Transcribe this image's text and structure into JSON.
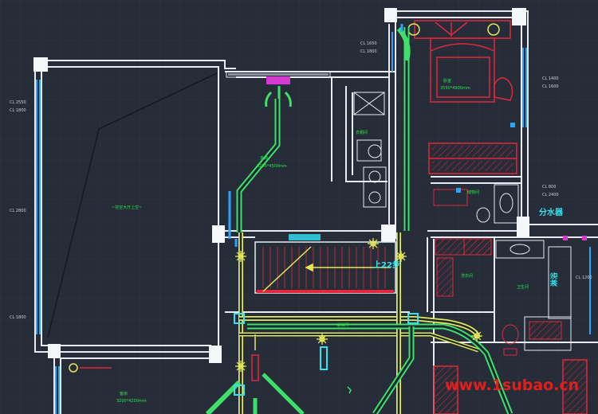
{
  "drawing": {
    "room_labels": {
      "large_room": "~挖空大厅上空~",
      "bedroom": "卧室",
      "bedroom_sub": "3550*4900mm",
      "mid_room": "走廊",
      "mid_room_sub": "3200*4500mm",
      "closet": "衣帽间",
      "stair_area": "楼梯间",
      "walk_in": "洗衣间",
      "bath": "卫生间",
      "bottom_left_room": "客房",
      "bottom_left_sub": "3200*4200mm",
      "storage": "储物间"
    },
    "divider_label": "分水器",
    "stair_label": "上22步",
    "shower_label": "淋浴",
    "dims_left": [
      "CL 2550",
      "CL 1800",
      "CL 2800",
      "CL 1800"
    ],
    "dims_right": [
      "CL 1400",
      "CL 1600",
      "CL 800",
      "CL 2400",
      "CL 1200"
    ],
    "dims_top": [
      "CL 1650",
      "CL 1800"
    ]
  },
  "watermark": {
    "text": "www.1subao.cn",
    "color": "#e0201c"
  },
  "colors": {
    "background": "#262c38",
    "grid": "#343c4a",
    "wall": "#e6ecf2",
    "pipe_green": "#3fe06a",
    "pipe_yellow": "#e6e857",
    "furniture_red": "#e0283a",
    "fixture_cyan": "#33e3ee",
    "window_blue": "#2aa4ff",
    "text_green": "#27e84a",
    "accent_magenta": "#d43ad0"
  }
}
